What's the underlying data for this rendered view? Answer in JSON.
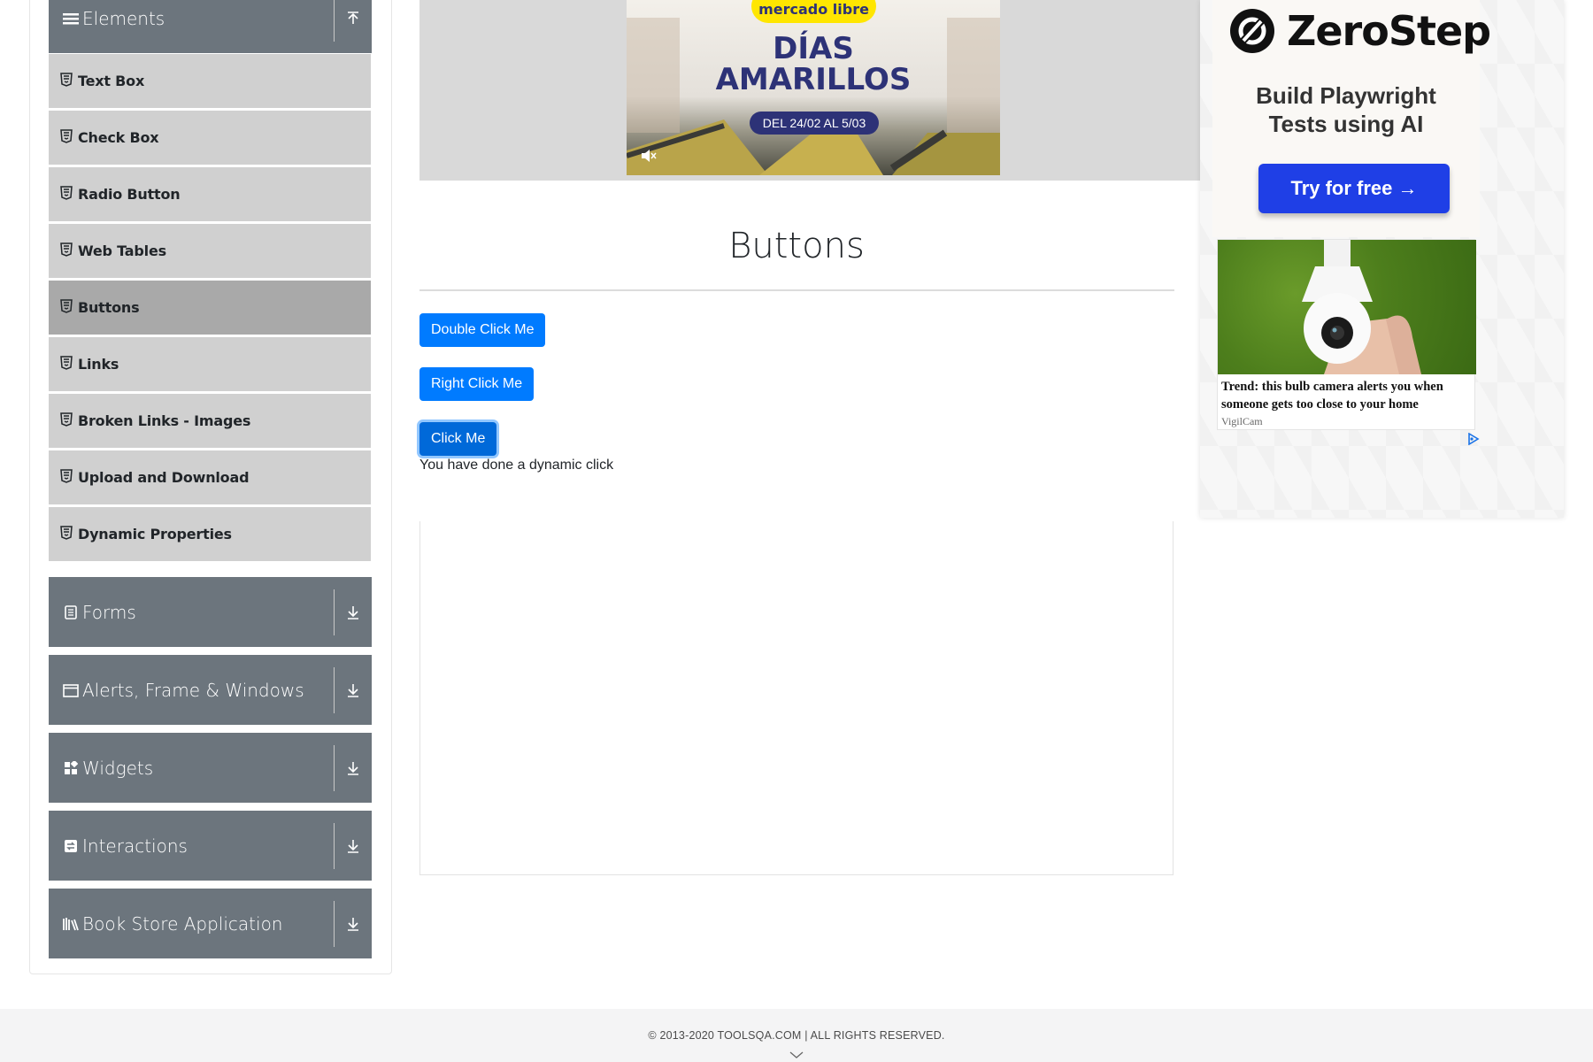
{
  "sidebar": {
    "elements_group": {
      "title": "Elements",
      "icon": "list-icon",
      "toggle_icon": "collapse-up-icon"
    },
    "items": [
      {
        "label": "Text Box",
        "active": false
      },
      {
        "label": "Check Box",
        "active": false
      },
      {
        "label": "Radio Button",
        "active": false
      },
      {
        "label": "Web Tables",
        "active": false
      },
      {
        "label": "Buttons",
        "active": true
      },
      {
        "label": "Links",
        "active": false
      },
      {
        "label": "Broken Links - Images",
        "active": false
      },
      {
        "label": "Upload and Download",
        "active": false
      },
      {
        "label": "Dynamic Properties",
        "active": false
      }
    ],
    "groups": [
      {
        "title": "Forms",
        "icon": "form-icon"
      },
      {
        "title": "Alerts, Frame & Windows",
        "icon": "window-icon"
      },
      {
        "title": "Widgets",
        "icon": "widgets-icon"
      },
      {
        "title": "Interactions",
        "icon": "interactions-icon"
      },
      {
        "title": "Book Store Application",
        "icon": "books-icon"
      }
    ]
  },
  "top_ad": {
    "brand": "mercado libre",
    "headline_line1": "DÍAS",
    "headline_line2": "AMARILLOS",
    "dates": "DEL 24/02 AL 5/03"
  },
  "main": {
    "title": "Buttons",
    "double_click_button": "Double Click Me",
    "right_click_button": "Right Click Me",
    "click_button": "Click Me",
    "dynamic_message": "You have done a dynamic click"
  },
  "right_ad": {
    "brand": "ZeroStep",
    "tagline_line1": "Build Playwright",
    "tagline_line2": "Tests using AI",
    "cta": "Try for free →",
    "promo_headline": "Trend: this bulb camera alerts you when someone gets too close to your home",
    "promo_brand": "VigilCam"
  },
  "footer": {
    "copyright": "© 2013-2020 TOOLSQA.COM | ALL RIGHTS RESERVED."
  },
  "colors": {
    "primary": "#007bff",
    "sidebar_header": "#6c757d",
    "sidebar_item": "#d0d0d0",
    "sidebar_active": "#a9a9a9"
  }
}
